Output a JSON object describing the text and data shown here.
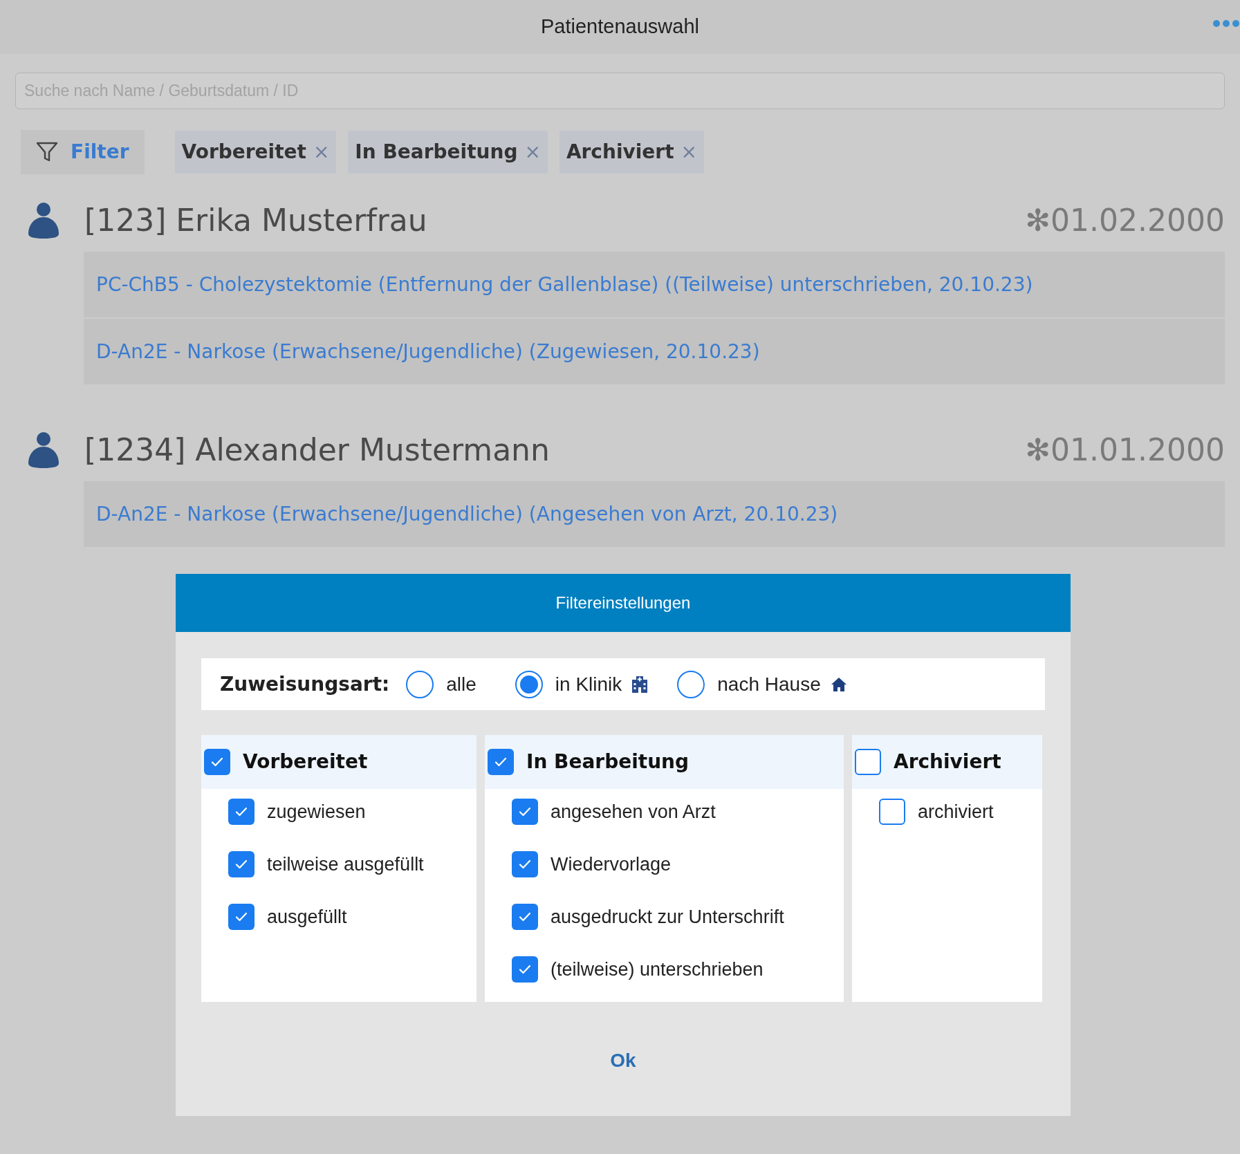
{
  "header": {
    "title": "Patientenauswahl"
  },
  "search": {
    "placeholder": "Suche nach Name / Geburtsdatum / ID"
  },
  "filter_button": {
    "label": "Filter"
  },
  "filter_chips": [
    {
      "label": "Vorbereitet",
      "remove": "×"
    },
    {
      "label": "In Bearbeitung",
      "remove": "×"
    },
    {
      "label": "Archiviert",
      "remove": "×"
    }
  ],
  "patients": [
    {
      "name": "[123] Erika Musterfrau",
      "birthdate": "✻01.02.2000",
      "documents": [
        "PC-ChB5 - Cholezystektomie (Entfernung der Gallenblase) ((Teilweise) unterschrieben, 20.10.23)",
        "D-An2E - Narkose (Erwachsene/Jugendliche) (Zugewiesen, 20.10.23)"
      ]
    },
    {
      "name": "[1234] Alexander Mustermann",
      "birthdate": "✻01.01.2000",
      "documents": [
        "D-An2E - Narkose (Erwachsene/Jugendliche) (Angesehen von Arzt, 20.10.23)"
      ]
    }
  ],
  "dialog": {
    "title": "Filtereinstellungen",
    "assignment": {
      "label": "Zuweisungsart:",
      "options": [
        {
          "label": "alle",
          "selected": false,
          "kind": "plain"
        },
        {
          "label": "in Klinik",
          "selected": true,
          "kind": "clinic"
        },
        {
          "label": "nach Hause",
          "selected": false,
          "kind": "home"
        }
      ]
    },
    "groups": [
      {
        "label": "Vorbereitet",
        "checked": true,
        "items": [
          {
            "label": "zugewiesen",
            "checked": true
          },
          {
            "label": "teilweise ausgefüllt",
            "checked": true
          },
          {
            "label": "ausgefüllt",
            "checked": true
          }
        ]
      },
      {
        "label": "In Bearbeitung",
        "checked": true,
        "items": [
          {
            "label": "angesehen von Arzt",
            "checked": true
          },
          {
            "label": "Wiedervorlage",
            "checked": true
          },
          {
            "label": "ausgedruckt zur Unterschrift",
            "checked": true
          },
          {
            "label": "(teilweise) unterschrieben",
            "checked": true
          }
        ]
      },
      {
        "label": "Archiviert",
        "checked": false,
        "items": [
          {
            "label": "archiviert",
            "checked": false
          }
        ]
      }
    ],
    "ok_button": "Ok"
  }
}
